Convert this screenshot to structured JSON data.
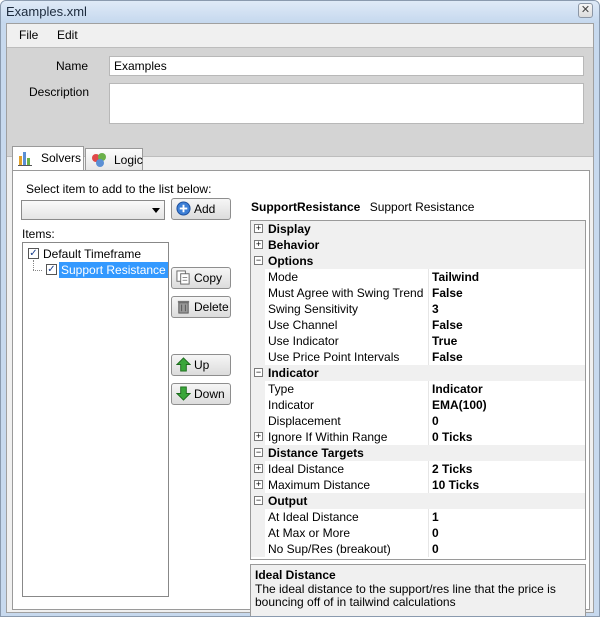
{
  "window": {
    "title": "Examples.xml",
    "close_glyph": "✕"
  },
  "menu": {
    "items": [
      "File",
      "Edit"
    ]
  },
  "header": {
    "name_label": "Name",
    "name_value": "Examples",
    "description_label": "Description",
    "description_value": ""
  },
  "tabs": [
    {
      "label": "Solvers",
      "icon": "bar-chart-icon",
      "active": true
    },
    {
      "label": "Logic",
      "icon": "puzzle-icon",
      "active": false
    }
  ],
  "solvers": {
    "select_label": "Select item to add to the list below:",
    "combo_value": "",
    "add_label": "Add",
    "items_label": "Items:",
    "items": [
      {
        "label": "Default Timeframe",
        "checked": true,
        "selected": false,
        "indent": 0
      },
      {
        "label": "Support Resistance",
        "checked": true,
        "selected": true,
        "indent": 1
      }
    ],
    "copy_label": "Copy",
    "delete_label": "Delete",
    "up_label": "Up",
    "down_label": "Down"
  },
  "property": {
    "object_type": "SupportResistance",
    "object_name": "Support Resistance",
    "rows": [
      {
        "kind": "category",
        "expanded": false,
        "name": "Display"
      },
      {
        "kind": "category",
        "expanded": false,
        "name": "Behavior"
      },
      {
        "kind": "category",
        "expanded": true,
        "name": "Options"
      },
      {
        "kind": "prop",
        "name": "Mode",
        "value": "Tailwind"
      },
      {
        "kind": "prop",
        "name": "Must Agree with Swing Trend",
        "value": "False"
      },
      {
        "kind": "prop",
        "name": "Swing Sensitivity",
        "value": "3"
      },
      {
        "kind": "prop",
        "name": "Use Channel",
        "value": "False"
      },
      {
        "kind": "prop",
        "name": "Use Indicator",
        "value": "True"
      },
      {
        "kind": "prop",
        "name": "Use Price Point Intervals",
        "value": "False"
      },
      {
        "kind": "category",
        "expanded": true,
        "name": "Indicator"
      },
      {
        "kind": "prop",
        "name": "Type",
        "value": "Indicator"
      },
      {
        "kind": "prop",
        "name": "Indicator",
        "value": "EMA(100)"
      },
      {
        "kind": "prop",
        "name": "Displacement",
        "value": "0"
      },
      {
        "kind": "subprop",
        "expanded": false,
        "name": "Ignore If Within Range",
        "value": "0 Ticks"
      },
      {
        "kind": "category",
        "expanded": true,
        "name": "Distance Targets"
      },
      {
        "kind": "subprop",
        "expanded": false,
        "name": "Ideal Distance",
        "value": "2 Ticks"
      },
      {
        "kind": "subprop",
        "expanded": false,
        "name": "Maximum Distance",
        "value": "10 Ticks"
      },
      {
        "kind": "category",
        "expanded": true,
        "name": "Output"
      },
      {
        "kind": "prop",
        "name": "At Ideal Distance",
        "value": "1"
      },
      {
        "kind": "prop",
        "name": "At Max or More",
        "value": "0"
      },
      {
        "kind": "prop",
        "name": "No Sup/Res (breakout)",
        "value": "0"
      }
    ],
    "description_title": "Ideal Distance",
    "description_text": "The ideal distance to the support/res line that the price is bouncing off of in tailwind calculations"
  },
  "colors": {
    "selection": "#3399ff",
    "window_frame": "#c7d9ee"
  }
}
